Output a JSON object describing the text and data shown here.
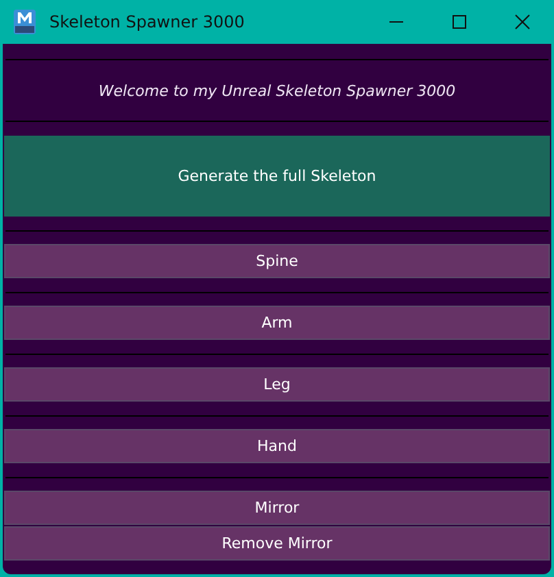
{
  "window": {
    "title": "Skeleton Spawner 3000"
  },
  "welcome": "Welcome to my Unreal Skeleton Spawner 3000",
  "generate_button": "Generate the full Skeleton",
  "part_buttons": [
    "Spine",
    "Arm",
    "Leg",
    "Hand"
  ],
  "mirror_buttons": [
    "Mirror",
    "Remove Mirror"
  ]
}
